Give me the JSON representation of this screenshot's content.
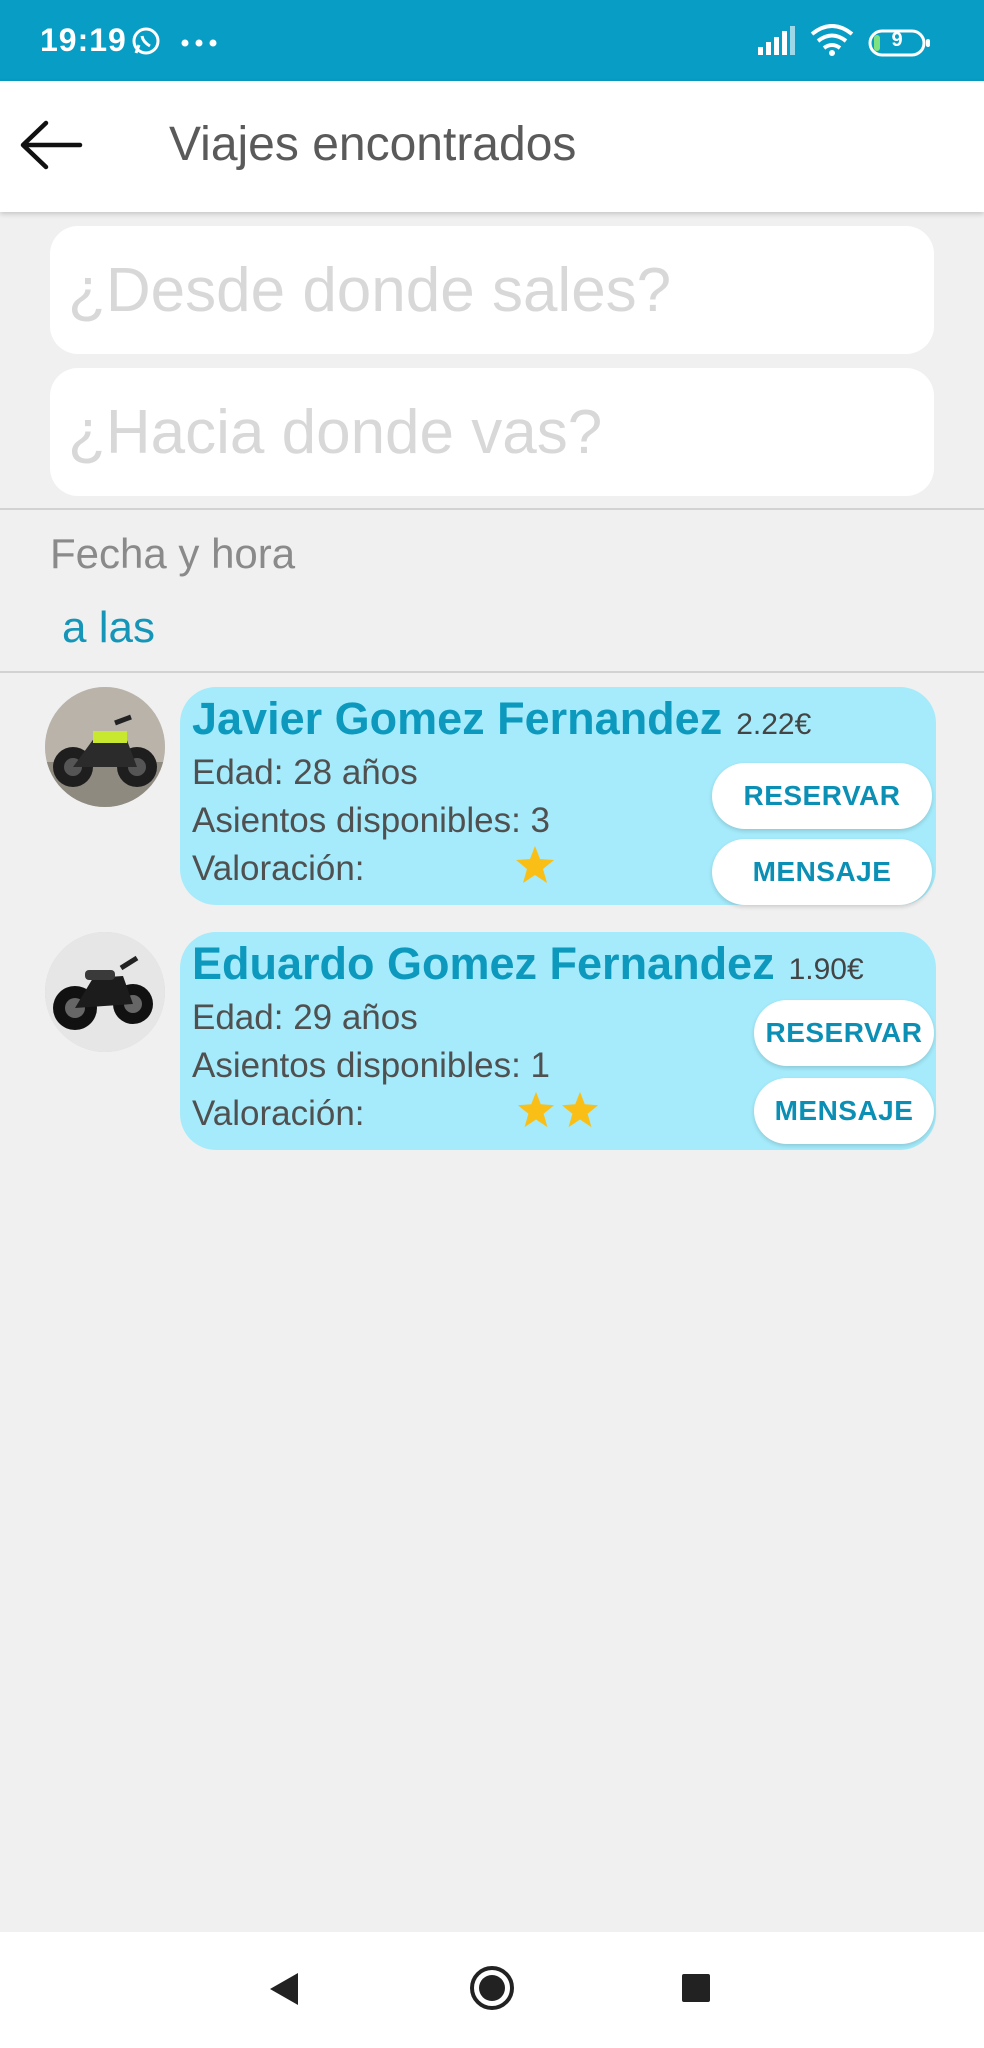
{
  "status_bar": {
    "time": "19:19",
    "battery_level": "9",
    "icons": [
      "whatsapp-icon",
      "more-dots-icon",
      "signal-icon",
      "wifi-icon",
      "battery-icon"
    ]
  },
  "header": {
    "title": "Viajes encontrados",
    "back_icon": "arrow-left-icon"
  },
  "search": {
    "origin_placeholder": "¿Desde donde sales?",
    "destination_placeholder": "¿Hacia donde vas?"
  },
  "date": {
    "label": "Fecha y hora",
    "time_link": "a las"
  },
  "trips": [
    {
      "name": "Javier Gomez Fernandez",
      "price": "2.22€",
      "age": "Edad: 28 años",
      "seats": "Asientos disponibles: 3",
      "rating_label": "Valoración:",
      "rating": 1,
      "reserve_label": "RESERVAR",
      "message_label": "MENSAJE",
      "avatar": "motorcycle-photo"
    },
    {
      "name": "Eduardo Gomez Fernandez",
      "price": "1.90€",
      "age": "Edad: 29 años",
      "seats": "Asientos disponibles: 1",
      "rating_label": "Valoración:",
      "rating": 2,
      "reserve_label": "RESERVAR",
      "message_label": "MENSAJE",
      "avatar": "motorcycle-photo"
    }
  ],
  "colors": {
    "status_bar": "#089dc4",
    "accent": "#0c99bd",
    "card": "#a5ebfb",
    "star": "#f9bf16",
    "background": "#f0f0f0"
  },
  "nav_bar": {
    "icons": [
      "back-triangle-icon",
      "home-circle-icon",
      "recents-square-icon"
    ]
  }
}
